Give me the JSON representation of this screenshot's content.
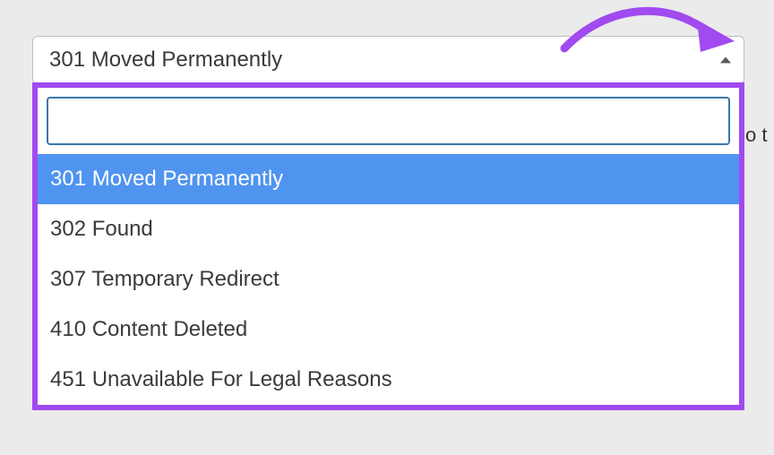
{
  "annotation": {
    "arrow_color": "#a14af0",
    "frame_color": "#a14af0"
  },
  "select": {
    "selected_label": "301 Moved Permanently",
    "search_value": "",
    "search_placeholder": "",
    "options": [
      {
        "label": "301 Moved Permanently",
        "selected": true
      },
      {
        "label": "302 Found",
        "selected": false
      },
      {
        "label": "307 Temporary Redirect",
        "selected": false
      },
      {
        "label": "410 Content Deleted",
        "selected": false
      },
      {
        "label": "451 Unavailable For Legal Reasons",
        "selected": false
      }
    ]
  },
  "behind_text": "o t"
}
